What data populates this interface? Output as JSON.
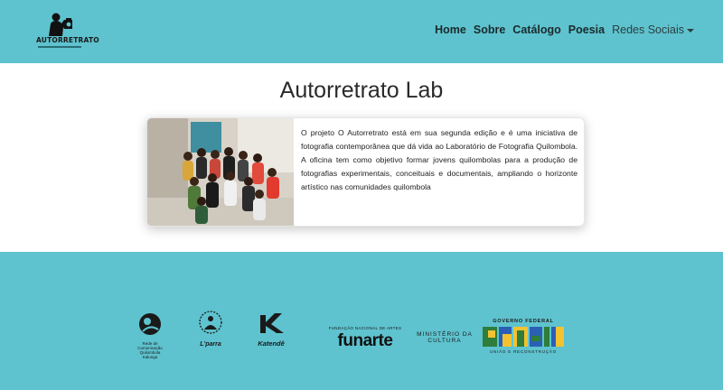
{
  "brand": {
    "logo_text": "AUTORRETRATO"
  },
  "nav": {
    "items": [
      {
        "label": "Home"
      },
      {
        "label": "Sobre"
      },
      {
        "label": "Catálogo"
      },
      {
        "label": "Poesia"
      }
    ],
    "dropdown_label": "Redes Sociais"
  },
  "main": {
    "title": "Autorretrato Lab",
    "card_text": "O projeto O Autorretrato está em sua segunda edição e é uma iniciativa de fotografia contemporânea que dá vida ao Laboratório de Fotografia Quilombola. A oficina tem como objetivo formar jovens quilombolas para a produção de fotografias experimentais, conceituais e documentais, ampliando o horizonte artístico nas comunidades quilombola"
  },
  "footer": {
    "partners": {
      "rede_label": "Rede de Comunicação Quilombola Kalunga",
      "lparra_label": "L'parra",
      "katende_label": "Katendê",
      "funarte_top": "FUNDAÇÃO NACIONAL DE ARTES",
      "funarte_name": "funarte",
      "ministerio_line1": "MINISTÉRIO DA",
      "ministerio_line2": "CULTURA",
      "gov_top": "GOVERNO FEDERAL",
      "gov_name": "BRASIL",
      "gov_bottom": "UNIÃO E RECONSTRUÇÃO"
    }
  },
  "colors": {
    "teal": "#5ec3cf",
    "nav_text": "#1b2a2c"
  }
}
